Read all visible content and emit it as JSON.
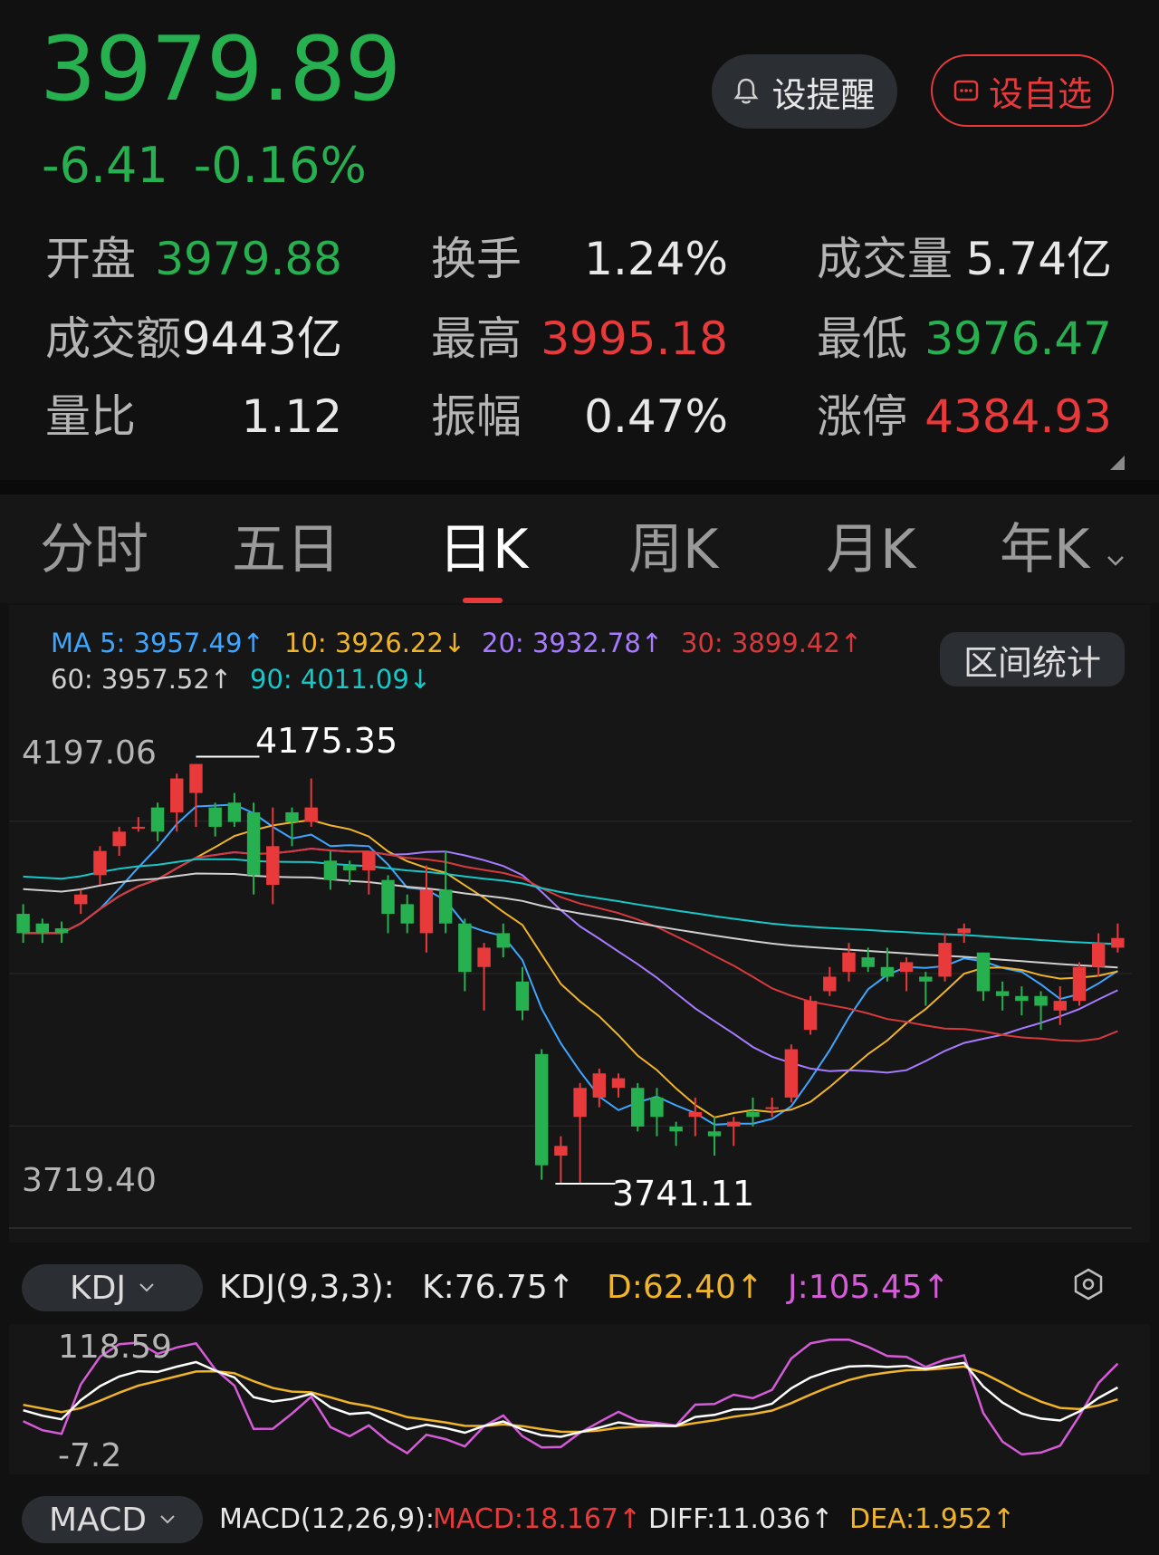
{
  "quote": {
    "price": "3979.89",
    "change": "-6.41",
    "change_pct": "-0.16%"
  },
  "actions": {
    "alert_label": "设提醒",
    "watch_label": "设自选"
  },
  "stats": [
    {
      "label": "开盘",
      "value": "3979.88",
      "color": "#27b04f"
    },
    {
      "label": "换手",
      "value": "1.24%",
      "color": "#e8e8e8"
    },
    {
      "label": "成交量",
      "value": "5.74亿",
      "color": "#e8e8e8"
    },
    {
      "label": "成交额",
      "value": "9443亿",
      "color": "#e8e8e8"
    },
    {
      "label": "最高",
      "value": "3995.18",
      "color": "#e8393b"
    },
    {
      "label": "最低",
      "value": "3976.47",
      "color": "#27b04f"
    },
    {
      "label": "量比",
      "value": "1.12",
      "color": "#e8e8e8"
    },
    {
      "label": "振幅",
      "value": "0.47%",
      "color": "#e8e8e8"
    },
    {
      "label": "涨停",
      "value": "4384.93",
      "color": "#e8393b"
    }
  ],
  "tabs": [
    {
      "label": "分时",
      "active": false
    },
    {
      "label": "五日",
      "active": false
    },
    {
      "label": "日K",
      "active": true
    },
    {
      "label": "周K",
      "active": false
    },
    {
      "label": "月K",
      "active": false
    },
    {
      "label": "年K",
      "active": false
    }
  ],
  "ma_legend": [
    {
      "text": "MA 5: 3957.49↑",
      "color": "#3ea6ff"
    },
    {
      "text": "10: 3926.22↓",
      "color": "#f0b429"
    },
    {
      "text": "20: 3932.78↑",
      "color": "#a77bff"
    },
    {
      "text": "30: 3899.42↑",
      "color": "#d8393c"
    },
    {
      "text": "60: 3957.52↑",
      "color": "#d0d0d0"
    },
    {
      "text": "90: 4011.09↓",
      "color": "#18c7c7"
    }
  ],
  "range_stat_label": "区间统计",
  "chart_data": {
    "type": "candlestick",
    "y_max_label": "4197.06",
    "y_min_label": "3719.40",
    "high_marker": "4175.35",
    "low_marker": "3741.11",
    "ylim": [
      3719.4,
      4197.06
    ],
    "candles": [
      [
        4020,
        4000,
        4030,
        3990
      ],
      [
        4010,
        4000,
        4015,
        3990
      ],
      [
        4005,
        4000,
        4012,
        3990
      ],
      [
        4030,
        4040,
        4045,
        4020
      ],
      [
        4060,
        4085,
        4090,
        4050
      ],
      [
        4090,
        4105,
        4110,
        4080
      ],
      [
        4110,
        4110,
        4120,
        4105
      ],
      [
        4130,
        4105,
        4135,
        4095
      ],
      [
        4125,
        4160,
        4165,
        4105
      ],
      [
        4145,
        4175,
        4175,
        4110
      ],
      [
        4130,
        4110,
        4135,
        4100
      ],
      [
        4135,
        4115,
        4145,
        4110
      ],
      [
        4125,
        4060,
        4135,
        4040
      ],
      [
        4050,
        4090,
        4130,
        4030
      ],
      [
        4125,
        4115,
        4130,
        4090
      ],
      [
        4115,
        4130,
        4160,
        4110
      ],
      [
        4075,
        4055,
        4085,
        4045
      ],
      [
        4070,
        4065,
        4075,
        4050
      ],
      [
        4065,
        4085,
        4080,
        4040
      ],
      [
        4055,
        4020,
        4060,
        4000
      ],
      [
        4030,
        4010,
        4040,
        4000
      ],
      [
        4000,
        4045,
        4070,
        3980
      ],
      [
        4045,
        4010,
        4085,
        4000
      ],
      [
        4010,
        3960,
        4015,
        3940
      ],
      [
        3965,
        3985,
        3990,
        3920
      ],
      [
        4000,
        3985,
        4010,
        3975
      ],
      [
        3950,
        3920,
        3965,
        3910
      ],
      [
        3875,
        3760,
        3880,
        3745
      ],
      [
        3770,
        3780,
        3790,
        3741
      ],
      [
        3810,
        3840,
        3845,
        3741
      ],
      [
        3830,
        3855,
        3860,
        3820
      ],
      [
        3840,
        3850,
        3855,
        3830
      ],
      [
        3840,
        3800,
        3845,
        3795
      ],
      [
        3830,
        3810,
        3840,
        3790
      ],
      [
        3800,
        3795,
        3805,
        3780
      ],
      [
        3810,
        3815,
        3830,
        3790
      ],
      [
        3795,
        3790,
        3810,
        3770
      ],
      [
        3800,
        3805,
        3810,
        3780
      ],
      [
        3815,
        3810,
        3830,
        3800
      ],
      [
        3820,
        3820,
        3830,
        3810
      ],
      [
        3830,
        3880,
        3885,
        3825
      ],
      [
        3900,
        3930,
        3935,
        3895
      ],
      [
        3940,
        3955,
        3965,
        3935
      ],
      [
        3960,
        3980,
        3990,
        3950
      ],
      [
        3975,
        3965,
        3985,
        3960
      ],
      [
        3965,
        3955,
        3985,
        3950
      ],
      [
        3960,
        3970,
        3975,
        3940
      ],
      [
        3955,
        3950,
        3960,
        3925
      ],
      [
        3955,
        3990,
        4000,
        3950
      ],
      [
        4000,
        4005,
        4010,
        3990
      ],
      [
        3980,
        3940,
        3980,
        3930
      ],
      [
        3940,
        3935,
        3950,
        3920
      ],
      [
        3935,
        3930,
        3945,
        3915
      ],
      [
        3935,
        3925,
        3940,
        3900
      ],
      [
        3920,
        3930,
        3945,
        3905
      ],
      [
        3930,
        3965,
        3970,
        3925
      ],
      [
        3965,
        3990,
        4000,
        3955
      ],
      [
        3985,
        3995,
        4010,
        3980
      ]
    ]
  },
  "kdj": {
    "pill": "KDJ",
    "params": "KDJ(9,3,3):",
    "k": "K:76.75↑",
    "d": "D:62.40↑",
    "j": "J:105.45↑",
    "y_max_label": "118.59",
    "y_min_label": "-7.2"
  },
  "macd": {
    "pill": "MACD",
    "params": "MACD(12,26,9):",
    "macd": "MACD:18.167↑",
    "diff": "DIFF:11.036↑",
    "dea": "DEA:1.952↑"
  }
}
